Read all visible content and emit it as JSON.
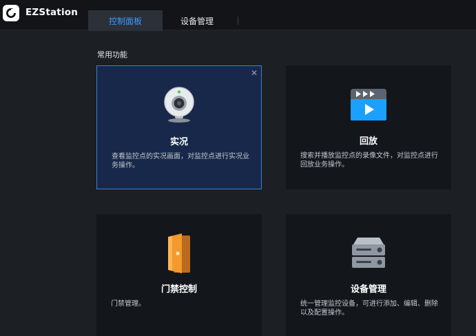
{
  "app": {
    "name": "EZStation"
  },
  "tabs": [
    {
      "label": "控制面板",
      "active": true
    },
    {
      "label": "设备管理",
      "active": false
    }
  ],
  "section": {
    "title": "常用功能"
  },
  "cards": [
    {
      "title": "实况",
      "desc": "查看监控点的实况画面，对监控点进行实况业务操作。",
      "icon": "webcam-icon",
      "active": true
    },
    {
      "title": "回放",
      "desc": "搜索并播放监控点的录像文件，对监控点进行回放业务操作。",
      "icon": "video-playback-icon",
      "active": false
    },
    {
      "title": "门禁控制",
      "desc": "门禁管理。",
      "icon": "door-icon",
      "active": false
    },
    {
      "title": "设备管理",
      "desc": "统一管理监控设备，可进行添加、编辑、删除以及配置操作。",
      "icon": "server-icon",
      "active": false
    }
  ],
  "colors": {
    "accent": "#3d9bff",
    "active_card": "#18284a",
    "card_bg": "#13161b",
    "page_bg": "#1c1f24"
  }
}
